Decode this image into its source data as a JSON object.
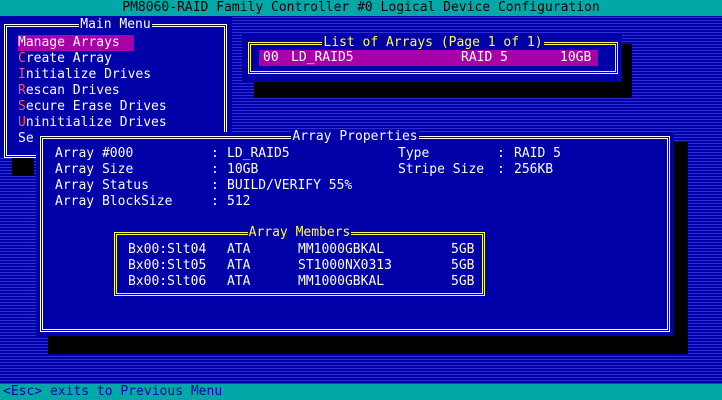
{
  "window": {
    "title": "PM8060-RAID Family Controller #0 Logical Device Configuration"
  },
  "main_menu": {
    "title": "Main Menu",
    "items": [
      {
        "hotkey": "M",
        "rest": "anage Arrays",
        "selected": true
      },
      {
        "hotkey": "C",
        "rest": "reate Array",
        "selected": false
      },
      {
        "hotkey": "I",
        "rest": "nitialize Drives",
        "selected": false
      },
      {
        "hotkey": "R",
        "rest": "escan Drives",
        "selected": false
      },
      {
        "hotkey": "S",
        "rest": "ecure Erase Drives",
        "selected": false
      },
      {
        "hotkey": "U",
        "rest": "ninitialize Drives",
        "selected": false
      },
      {
        "hotkey": "Se",
        "rest": "",
        "selected": false
      }
    ]
  },
  "array_list": {
    "title": "List of Arrays (Page 1 of 1)",
    "rows": [
      {
        "id": "00",
        "name": "LD_RAID5",
        "raid": "RAID 5",
        "size": "10GB"
      }
    ]
  },
  "array_properties": {
    "title": "Array Properties",
    "fields": [
      {
        "label": "Array #000",
        "value": "LD_RAID5"
      },
      {
        "label": "Array Size",
        "value": "10GB"
      },
      {
        "label": "Array Status",
        "value": "BUILD/VERIFY 55%"
      },
      {
        "label": "Array BlockSize",
        "value": "512"
      }
    ],
    "right_fields": [
      {
        "label": "Type",
        "value": "RAID 5"
      },
      {
        "label": "Stripe Size",
        "value": "256KB"
      }
    ]
  },
  "array_members": {
    "title": "Array Members",
    "rows": [
      {
        "slot": "Bx00:Slt04",
        "type": "ATA",
        "model": "MM1000GBKAL",
        "size": "5GB"
      },
      {
        "slot": "Bx00:Slt05",
        "type": "ATA",
        "model": "ST1000NX0313",
        "size": "5GB"
      },
      {
        "slot": "Bx00:Slt06",
        "type": "ATA",
        "model": "MM1000GBKAL",
        "size": "5GB"
      }
    ]
  },
  "status_bar": {
    "text": "<Esc> exits to Previous Menu"
  },
  "colors": {
    "background": "#0000a8",
    "bar": "#00a8a8",
    "highlight": "#a800a8",
    "hotkey": "#fc5454",
    "accent_border": "#fcfc54"
  }
}
